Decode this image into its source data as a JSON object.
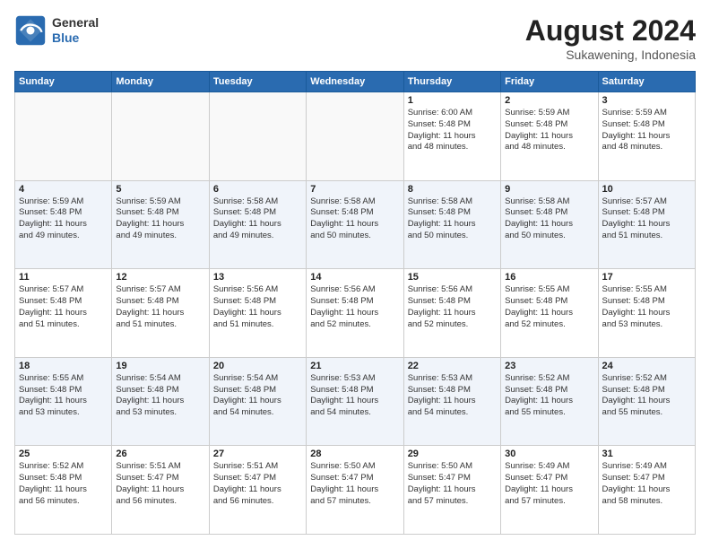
{
  "header": {
    "logo": {
      "general": "General",
      "blue": "Blue"
    },
    "title": "August 2024",
    "location": "Sukawening, Indonesia"
  },
  "weekdays": [
    "Sunday",
    "Monday",
    "Tuesday",
    "Wednesday",
    "Thursday",
    "Friday",
    "Saturday"
  ],
  "weeks": [
    [
      {
        "day": "",
        "info": ""
      },
      {
        "day": "",
        "info": ""
      },
      {
        "day": "",
        "info": ""
      },
      {
        "day": "",
        "info": ""
      },
      {
        "day": "1",
        "info": "Sunrise: 6:00 AM\nSunset: 5:48 PM\nDaylight: 11 hours\nand 48 minutes."
      },
      {
        "day": "2",
        "info": "Sunrise: 5:59 AM\nSunset: 5:48 PM\nDaylight: 11 hours\nand 48 minutes."
      },
      {
        "day": "3",
        "info": "Sunrise: 5:59 AM\nSunset: 5:48 PM\nDaylight: 11 hours\nand 48 minutes."
      }
    ],
    [
      {
        "day": "4",
        "info": "Sunrise: 5:59 AM\nSunset: 5:48 PM\nDaylight: 11 hours\nand 49 minutes."
      },
      {
        "day": "5",
        "info": "Sunrise: 5:59 AM\nSunset: 5:48 PM\nDaylight: 11 hours\nand 49 minutes."
      },
      {
        "day": "6",
        "info": "Sunrise: 5:58 AM\nSunset: 5:48 PM\nDaylight: 11 hours\nand 49 minutes."
      },
      {
        "day": "7",
        "info": "Sunrise: 5:58 AM\nSunset: 5:48 PM\nDaylight: 11 hours\nand 50 minutes."
      },
      {
        "day": "8",
        "info": "Sunrise: 5:58 AM\nSunset: 5:48 PM\nDaylight: 11 hours\nand 50 minutes."
      },
      {
        "day": "9",
        "info": "Sunrise: 5:58 AM\nSunset: 5:48 PM\nDaylight: 11 hours\nand 50 minutes."
      },
      {
        "day": "10",
        "info": "Sunrise: 5:57 AM\nSunset: 5:48 PM\nDaylight: 11 hours\nand 51 minutes."
      }
    ],
    [
      {
        "day": "11",
        "info": "Sunrise: 5:57 AM\nSunset: 5:48 PM\nDaylight: 11 hours\nand 51 minutes."
      },
      {
        "day": "12",
        "info": "Sunrise: 5:57 AM\nSunset: 5:48 PM\nDaylight: 11 hours\nand 51 minutes."
      },
      {
        "day": "13",
        "info": "Sunrise: 5:56 AM\nSunset: 5:48 PM\nDaylight: 11 hours\nand 51 minutes."
      },
      {
        "day": "14",
        "info": "Sunrise: 5:56 AM\nSunset: 5:48 PM\nDaylight: 11 hours\nand 52 minutes."
      },
      {
        "day": "15",
        "info": "Sunrise: 5:56 AM\nSunset: 5:48 PM\nDaylight: 11 hours\nand 52 minutes."
      },
      {
        "day": "16",
        "info": "Sunrise: 5:55 AM\nSunset: 5:48 PM\nDaylight: 11 hours\nand 52 minutes."
      },
      {
        "day": "17",
        "info": "Sunrise: 5:55 AM\nSunset: 5:48 PM\nDaylight: 11 hours\nand 53 minutes."
      }
    ],
    [
      {
        "day": "18",
        "info": "Sunrise: 5:55 AM\nSunset: 5:48 PM\nDaylight: 11 hours\nand 53 minutes."
      },
      {
        "day": "19",
        "info": "Sunrise: 5:54 AM\nSunset: 5:48 PM\nDaylight: 11 hours\nand 53 minutes."
      },
      {
        "day": "20",
        "info": "Sunrise: 5:54 AM\nSunset: 5:48 PM\nDaylight: 11 hours\nand 54 minutes."
      },
      {
        "day": "21",
        "info": "Sunrise: 5:53 AM\nSunset: 5:48 PM\nDaylight: 11 hours\nand 54 minutes."
      },
      {
        "day": "22",
        "info": "Sunrise: 5:53 AM\nSunset: 5:48 PM\nDaylight: 11 hours\nand 54 minutes."
      },
      {
        "day": "23",
        "info": "Sunrise: 5:52 AM\nSunset: 5:48 PM\nDaylight: 11 hours\nand 55 minutes."
      },
      {
        "day": "24",
        "info": "Sunrise: 5:52 AM\nSunset: 5:48 PM\nDaylight: 11 hours\nand 55 minutes."
      }
    ],
    [
      {
        "day": "25",
        "info": "Sunrise: 5:52 AM\nSunset: 5:48 PM\nDaylight: 11 hours\nand 56 minutes."
      },
      {
        "day": "26",
        "info": "Sunrise: 5:51 AM\nSunset: 5:47 PM\nDaylight: 11 hours\nand 56 minutes."
      },
      {
        "day": "27",
        "info": "Sunrise: 5:51 AM\nSunset: 5:47 PM\nDaylight: 11 hours\nand 56 minutes."
      },
      {
        "day": "28",
        "info": "Sunrise: 5:50 AM\nSunset: 5:47 PM\nDaylight: 11 hours\nand 57 minutes."
      },
      {
        "day": "29",
        "info": "Sunrise: 5:50 AM\nSunset: 5:47 PM\nDaylight: 11 hours\nand 57 minutes."
      },
      {
        "day": "30",
        "info": "Sunrise: 5:49 AM\nSunset: 5:47 PM\nDaylight: 11 hours\nand 57 minutes."
      },
      {
        "day": "31",
        "info": "Sunrise: 5:49 AM\nSunset: 5:47 PM\nDaylight: 11 hours\nand 58 minutes."
      }
    ]
  ]
}
